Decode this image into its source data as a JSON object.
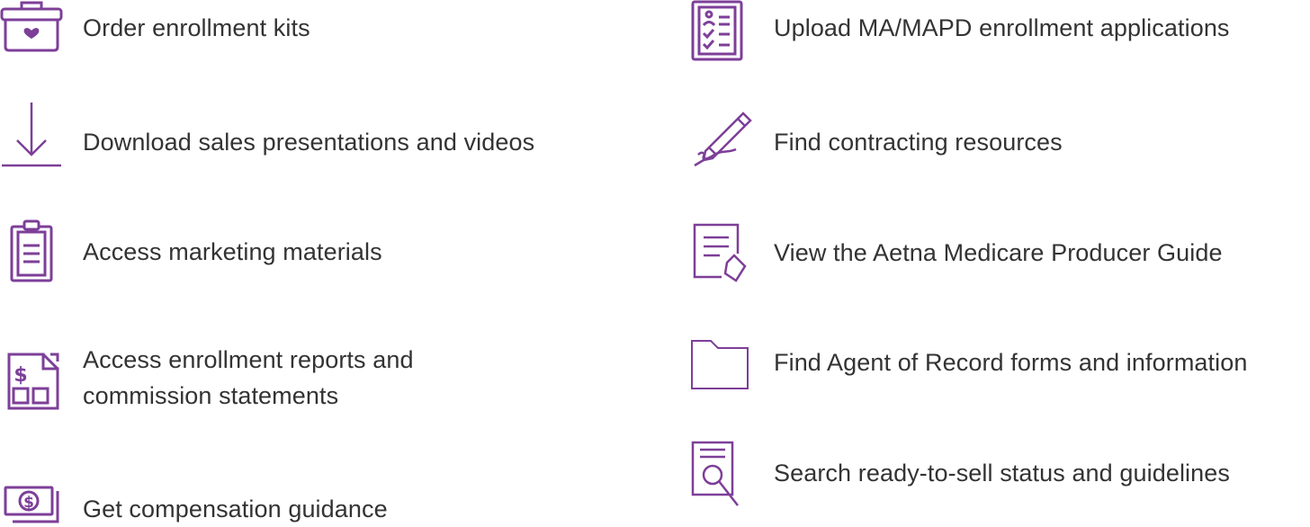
{
  "theme": {
    "icon_color": "#7d3f98",
    "text_color": "#333333",
    "background": "#ffffff"
  },
  "left_column": [
    {
      "icon": "enrollment-kit-icon",
      "label_lines": [
        "Order enrollment kits"
      ]
    },
    {
      "icon": "download-icon",
      "label_lines": [
        "Download sales presentations and videos"
      ]
    },
    {
      "icon": "clipboard-icon",
      "label_lines": [
        "Access marketing materials"
      ]
    },
    {
      "icon": "dollar-report-icon",
      "label_lines": [
        "Access enrollment reports and",
        "commission statements"
      ]
    },
    {
      "icon": "money-bill-icon",
      "label_lines": [
        "Get compensation guidance"
      ]
    }
  ],
  "right_column": [
    {
      "icon": "checklist-clipboard-icon",
      "label_lines": [
        "Upload MA/MAPD enrollment applications"
      ]
    },
    {
      "icon": "pen-signature-icon",
      "label_lines": [
        "Find contracting resources"
      ]
    },
    {
      "icon": "document-tag-icon",
      "label_lines": [
        "View the Aetna Medicare Producer Guide"
      ]
    },
    {
      "icon": "folder-icon",
      "label_lines": [
        "Find Agent of Record forms and information"
      ]
    },
    {
      "icon": "document-search-icon",
      "label_lines": [
        "Search ready-to-sell status and guidelines"
      ]
    }
  ]
}
